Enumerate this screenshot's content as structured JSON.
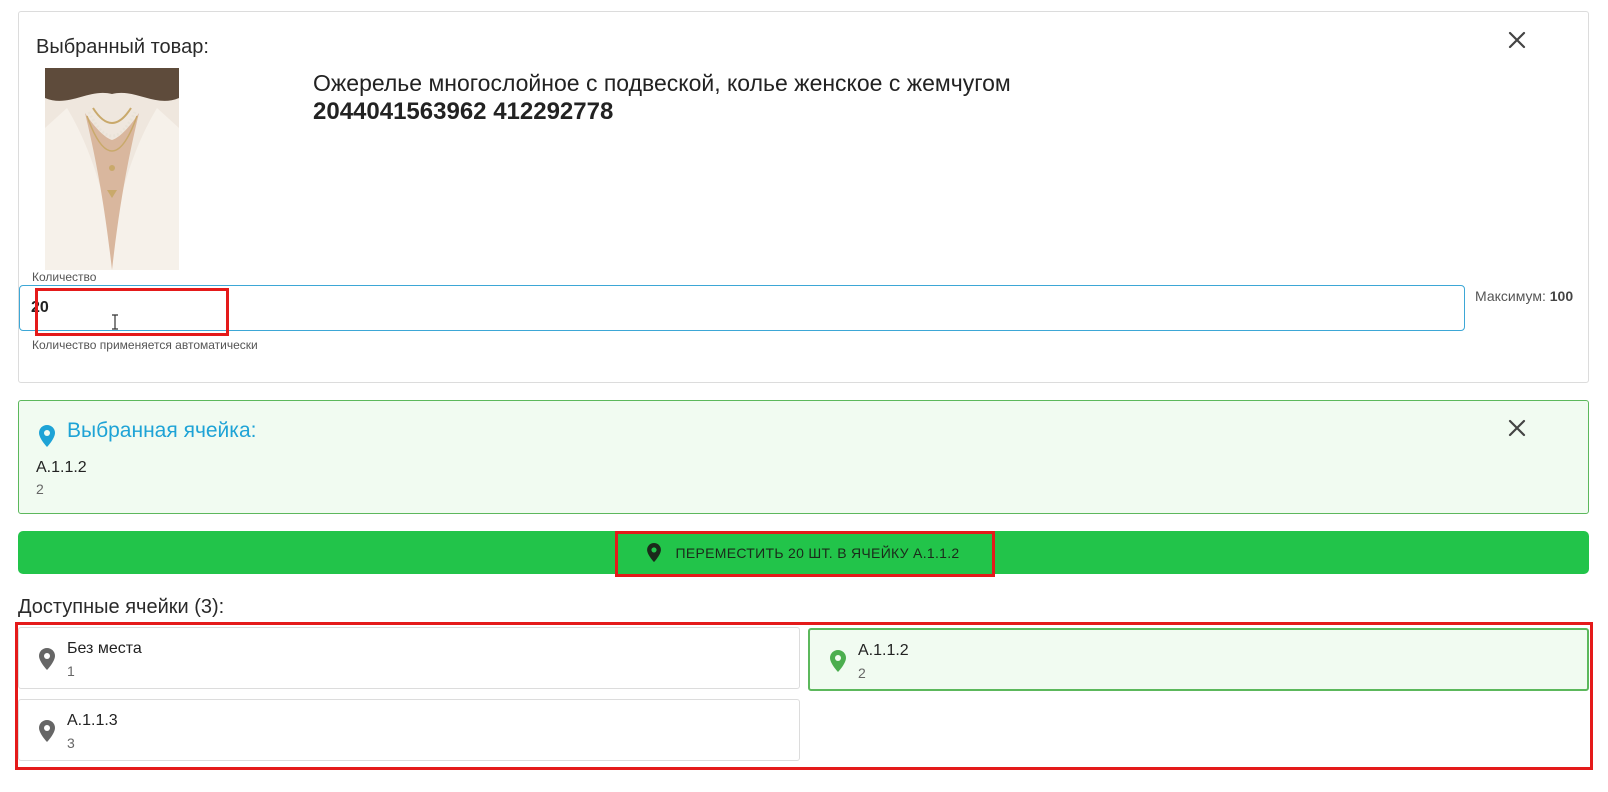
{
  "product": {
    "title": "Выбранный товар:",
    "name": "Ожерелье многослойное с подвеской, колье женское с жемчугом",
    "codes": "2044041563962 412292778",
    "quantity_label": "Количество",
    "quantity_value": "20",
    "quantity_hint": "Количество применяется автоматически",
    "max_label": "Максимум:",
    "max_value": "100",
    "close_icon": "close-icon"
  },
  "selected_cell": {
    "title": "Выбранная ячейка:",
    "code": "А.1.1.2",
    "sub": "2",
    "icon": "map-pin-icon",
    "color": "#1ea3d6"
  },
  "move_button": {
    "label": "ПЕРЕМЕСТИТЬ 20 ШТ. В ЯЧЕЙКУ А.1.1.2",
    "color": "#22c44a"
  },
  "available": {
    "title": "Доступные ячейки (3):",
    "cells": [
      {
        "name": "Без места",
        "sub": "1",
        "selected": false
      },
      {
        "name": "А.1.1.2",
        "sub": "2",
        "selected": true
      },
      {
        "name": "А.1.1.3",
        "sub": "3",
        "selected": false
      }
    ]
  }
}
